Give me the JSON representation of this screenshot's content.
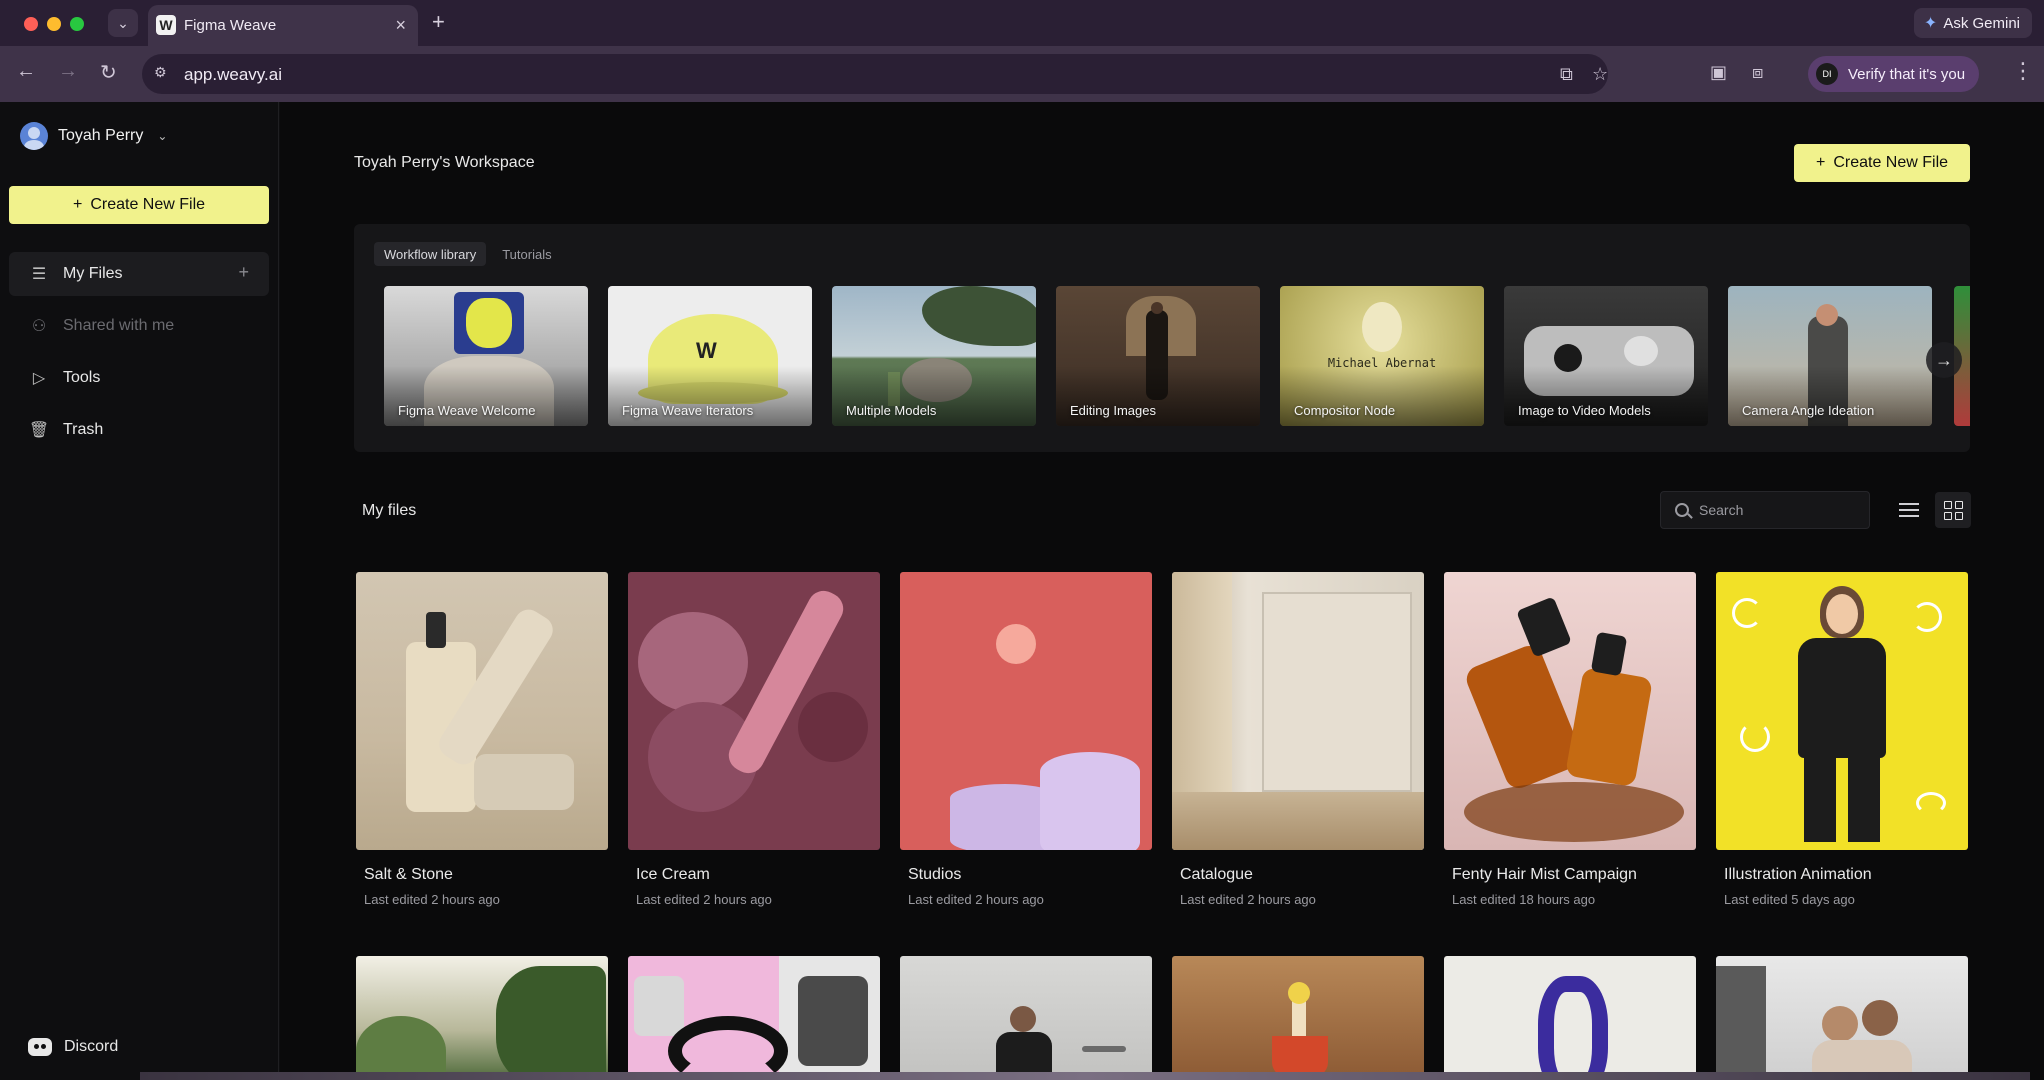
{
  "browser": {
    "tab_title": "Figma Weave",
    "tab_favicon": "W",
    "url": "app.weavy.ai",
    "ask_gemini": "Ask Gemini",
    "verify_label": "Verify that it's you",
    "verify_avatar": "DI"
  },
  "sidebar": {
    "user_name": "Toyah Perry",
    "create_label": "Create New File",
    "items": [
      {
        "label": "My Files",
        "icon": "files-icon"
      },
      {
        "label": "Shared with me",
        "icon": "shared-icon"
      },
      {
        "label": "Tools",
        "icon": "tools-icon"
      },
      {
        "label": "Trash",
        "icon": "trash-icon"
      }
    ],
    "discord_label": "Discord"
  },
  "main": {
    "workspace_title": "Toyah Perry's Workspace",
    "create_label": "Create New File",
    "workflow_tabs": [
      "Workflow library",
      "Tutorials"
    ],
    "workflows": [
      {
        "label": "Figma Weave Welcome"
      },
      {
        "label": "Figma Weave Iterators"
      },
      {
        "label": "Multiple Models"
      },
      {
        "label": "Editing Images"
      },
      {
        "label": "Compositor Node"
      },
      {
        "label": "Image to Video Models"
      },
      {
        "label": "Camera Angle Ideation"
      }
    ],
    "compositor_text": "Michael Abernat",
    "my_files_title": "My files",
    "search_placeholder": "Search",
    "files": [
      {
        "name": "Salt & Stone",
        "edited": "Last edited 2 hours ago"
      },
      {
        "name": "Ice Cream",
        "edited": "Last edited 2 hours ago"
      },
      {
        "name": "Studios",
        "edited": "Last edited 2 hours ago"
      },
      {
        "name": "Catalogue",
        "edited": "Last edited 2 hours ago"
      },
      {
        "name": "Fenty Hair Mist Campaign",
        "edited": "Last edited 18 hours ago"
      },
      {
        "name": "Illustration Animation",
        "edited": "Last edited 5 days ago"
      }
    ]
  },
  "colors": {
    "accent": "#f1f28c",
    "chrome_dark": "#2a1f34",
    "chrome": "#3f3349",
    "background": "#0a0a0b"
  }
}
